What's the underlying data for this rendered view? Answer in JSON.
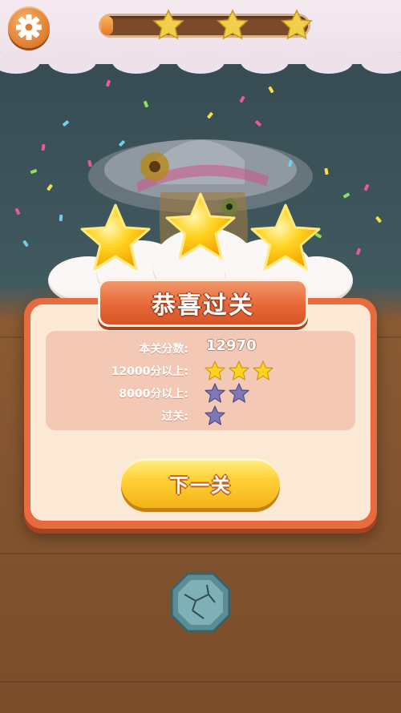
{
  "header": {
    "settings_icon": "gear-icon",
    "level_progress": 0.06,
    "progress_stars": 3
  },
  "result": {
    "title": "恭喜过关",
    "earned_stars": 3,
    "stats": [
      {
        "label": "本关分数:",
        "value": "12970"
      },
      {
        "label": "12000分以上:",
        "stars": 3,
        "star_color": "gold"
      },
      {
        "label": "8000分以上:",
        "stars": 2,
        "star_color": "purple"
      },
      {
        "label": "过关:",
        "stars": 1,
        "star_color": "purple"
      }
    ],
    "next_button_label": "下一关"
  },
  "colors": {
    "panel_orange": "#e86a3f",
    "panel_cream": "#fbe9d6",
    "stats_pink": "#f3c8b4",
    "button_yellow": "#ffd23a",
    "star_gold": "#ffd21f",
    "star_purple": "#7e78b8"
  },
  "board_item_icon": "stone-gem-icon"
}
